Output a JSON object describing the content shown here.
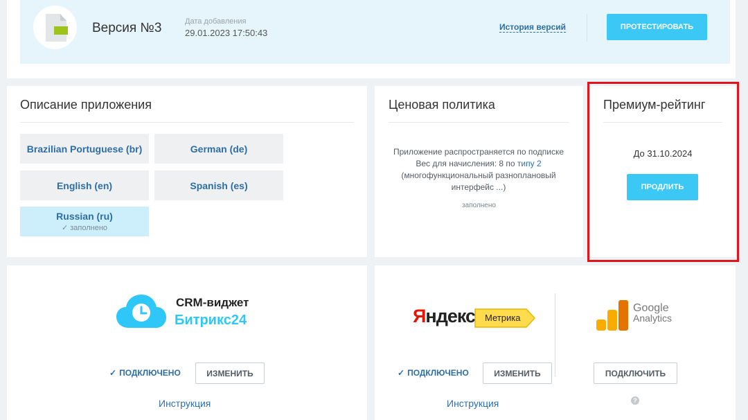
{
  "version": {
    "title": "Версия №3",
    "date_label": "Дата добавления",
    "date_value": "29.01.2023 17:50:43",
    "history_link": "История версий",
    "test_button": "ПРОТЕСТИРОВАТЬ"
  },
  "description": {
    "title": "Описание приложения",
    "languages": [
      {
        "label": "Brazilian Portuguese (br)"
      },
      {
        "label": "German (de)"
      },
      {
        "label": "English (en)"
      },
      {
        "label": "Spanish (es)"
      },
      {
        "label": "Russian (ru)",
        "status": "заполнено"
      }
    ]
  },
  "pricing": {
    "title": "Ценовая политика",
    "line1": "Приложение распространяется по подписке",
    "line2_prefix": "Вес для начисления: 8 по ",
    "line2_link": "типу 2",
    "line3": "(многофункциональный разноплановый интерфейс ",
    "line3_more": "...",
    "line3_end": ")",
    "status": "заполнено"
  },
  "premium": {
    "title": "Премиум-рейтинг",
    "date": "До 31.10.2024",
    "extend_button": "ПРОДЛИТЬ"
  },
  "crm": {
    "logo_title": "CRM-виджет",
    "logo_brand": "Битрикс24",
    "status": "ПОДКЛЮЧЕНО",
    "change_button": "ИЗМЕНИТЬ",
    "instruction": "Инструкция"
  },
  "yandex": {
    "logo_word_first": "Я",
    "logo_word_rest": "ндекс",
    "logo_tag": "Метрика",
    "status": "ПОДКЛЮЧЕНО",
    "change_button": "ИЗМЕНИТЬ",
    "instruction": "Инструкция"
  },
  "google": {
    "logo_line1": "Google",
    "logo_line2": "Analytics",
    "connect_button": "ПОДКЛЮЧИТЬ",
    "help_icon": "?"
  },
  "colors": {
    "accent": "#3bc8f5",
    "link": "#2e6ea6",
    "highlight": "#e0141d",
    "bitrix_blue": "#2fc7f7",
    "yandex_red": "#e61400",
    "metrika_yellow": "#ffdb4d"
  }
}
